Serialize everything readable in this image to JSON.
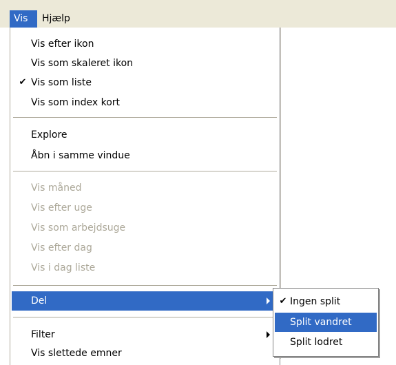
{
  "menubar": {
    "items": [
      {
        "label": "Vis",
        "active": true
      },
      {
        "label": "Hjælp",
        "active": false
      }
    ]
  },
  "menu": {
    "groups": [
      {
        "items": [
          {
            "label": "Vis efter ikon",
            "checked": false,
            "enabled": true
          },
          {
            "label": "Vis som skaleret ikon",
            "checked": false,
            "enabled": true
          },
          {
            "label": "Vis som liste",
            "checked": true,
            "enabled": true
          },
          {
            "label": "Vis som index kort",
            "checked": false,
            "enabled": true
          }
        ]
      },
      {
        "items": [
          {
            "label": "Explore",
            "enabled": true
          },
          {
            "label": "Åbn i samme vindue",
            "enabled": true
          }
        ]
      },
      {
        "items": [
          {
            "label": "Vis måned",
            "enabled": false
          },
          {
            "label": "Vis efter uge",
            "enabled": false
          },
          {
            "label": "Vis som arbejdsuge",
            "enabled": false
          },
          {
            "label": "Vis efter dag",
            "enabled": false
          },
          {
            "label": "Vis i dag liste",
            "enabled": false
          }
        ]
      },
      {
        "items": [
          {
            "label": "Del",
            "enabled": true,
            "has_submenu": true,
            "highlighted": true
          }
        ]
      },
      {
        "items": [
          {
            "label": "Filter",
            "enabled": true,
            "has_submenu": true
          },
          {
            "label": "Vis slettede emner",
            "enabled": true
          }
        ]
      }
    ],
    "check_glyph": "✔"
  },
  "submenu": {
    "items": [
      {
        "label": "Ingen split",
        "checked": true
      },
      {
        "label": "Split vandret",
        "checked": false,
        "highlighted": true
      },
      {
        "label": "Split lodret",
        "checked": false
      }
    ]
  },
  "colors": {
    "highlight": "#316ac5",
    "menubar_bg": "#ece9d8",
    "disabled_text": "#aca899"
  }
}
